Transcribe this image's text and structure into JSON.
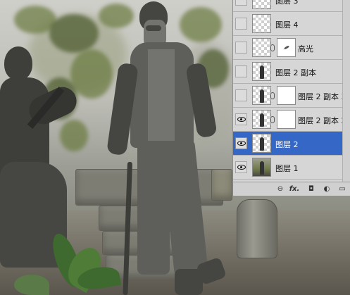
{
  "layers_panel": {
    "layers": [
      {
        "name": "图层 3",
        "visible": false,
        "thumb": "transparent",
        "mask": false,
        "selected": false
      },
      {
        "name": "图层 4",
        "visible": false,
        "thumb": "transparent",
        "mask": false,
        "selected": false
      },
      {
        "name": "高光",
        "visible": false,
        "thumb": "transparent",
        "mask": true,
        "selected": false
      },
      {
        "name": "图层 2 副本",
        "visible": false,
        "thumb": "figure",
        "mask": false,
        "selected": false
      },
      {
        "name": "图层 2 副本 3",
        "visible": false,
        "thumb": "figure",
        "mask": true,
        "selected": false
      },
      {
        "name": "图层 2 副本 2",
        "visible": true,
        "thumb": "figure",
        "mask": true,
        "selected": false
      },
      {
        "name": "图层 2",
        "visible": true,
        "thumb": "figure",
        "mask": false,
        "selected": true
      },
      {
        "name": "图层 1",
        "visible": true,
        "thumb": "photo",
        "mask": false,
        "selected": false
      }
    ],
    "footer_icons": [
      "link-icon",
      "fx-icon",
      "add-mask-icon",
      "adjustment-icon",
      "new-group-icon"
    ],
    "footer_glyphs": {
      "link": "⊖",
      "fx": "fx.",
      "mask": "◘",
      "adjust": "◐",
      "group": "▭"
    },
    "selection_color": "#3567c7"
  }
}
